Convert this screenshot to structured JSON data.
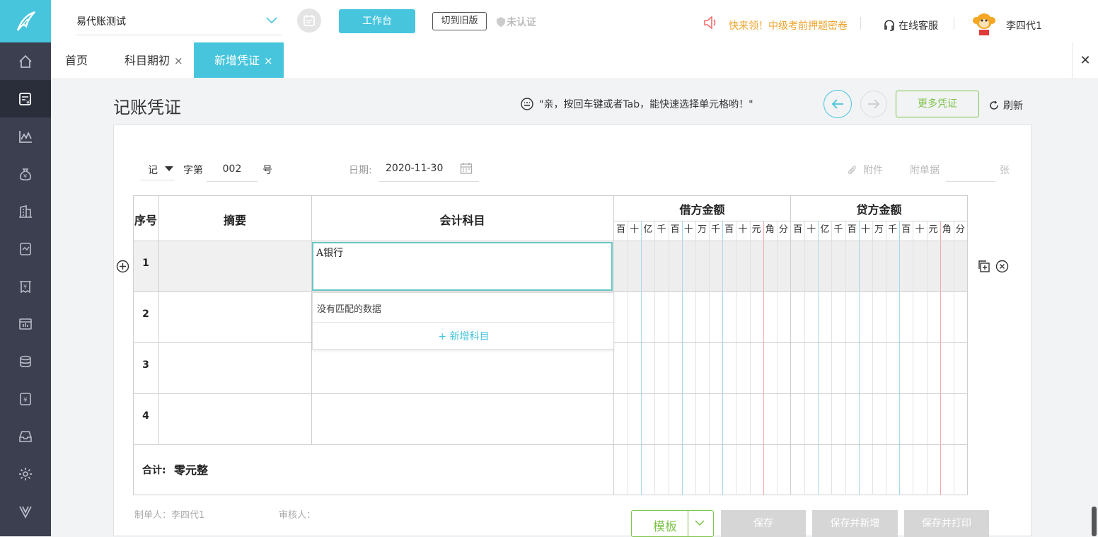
{
  "topbar": {
    "company": "易代账测试",
    "workbench_label": "工作台",
    "old_version_label": "切到旧版",
    "unverified_label": "未认证",
    "promo_text": "快来领！中级考前押题密卷",
    "service_label": "在线客服",
    "user_name": "李四代1"
  },
  "tabs": [
    {
      "label": "首页"
    },
    {
      "label": "科目期初",
      "close": "×"
    },
    {
      "label": "新增凭证",
      "close": "×"
    }
  ],
  "close_all": "✕",
  "page": {
    "title": "记账凭证",
    "tip": "\"亲，按回车键或者Tab，能快速选择单元格哟！\"",
    "more_vouchers": "更多凭证",
    "refresh": "刷新"
  },
  "voucher": {
    "word": "记",
    "zi_label": "字第",
    "number": "002",
    "hao_label": "号",
    "date_label": "日期:",
    "date": "2020-11-30",
    "attachment_label": "附件",
    "bill_label": "附单据",
    "zhang_label": "张"
  },
  "table": {
    "col_seq": "序号",
    "col_summary": "摘要",
    "col_account": "会计科目",
    "col_debit": "借方金额",
    "col_credit": "贷方金额",
    "digits": [
      "百",
      "十",
      "亿",
      "千",
      "百",
      "十",
      "万",
      "千",
      "百",
      "十",
      "元",
      "角",
      "分"
    ],
    "rows": [
      "1",
      "2",
      "3",
      "4"
    ],
    "account_input": "A银行",
    "dropdown_empty": "没有匹配的数据",
    "dropdown_add": "+ 新增科目",
    "total_label": "合计:",
    "total_value": "零元整"
  },
  "footer": {
    "maker": "制单人：李四代1",
    "reviewer": "审核人：",
    "template": "模板",
    "save": "保存",
    "save_new": "保存并新增",
    "save_print": "保存并打印"
  },
  "colors": {
    "accent": "#47c5dd",
    "sidebar": "#3b3f4f",
    "green": "#7ec34a",
    "orange": "#f0a32b"
  }
}
